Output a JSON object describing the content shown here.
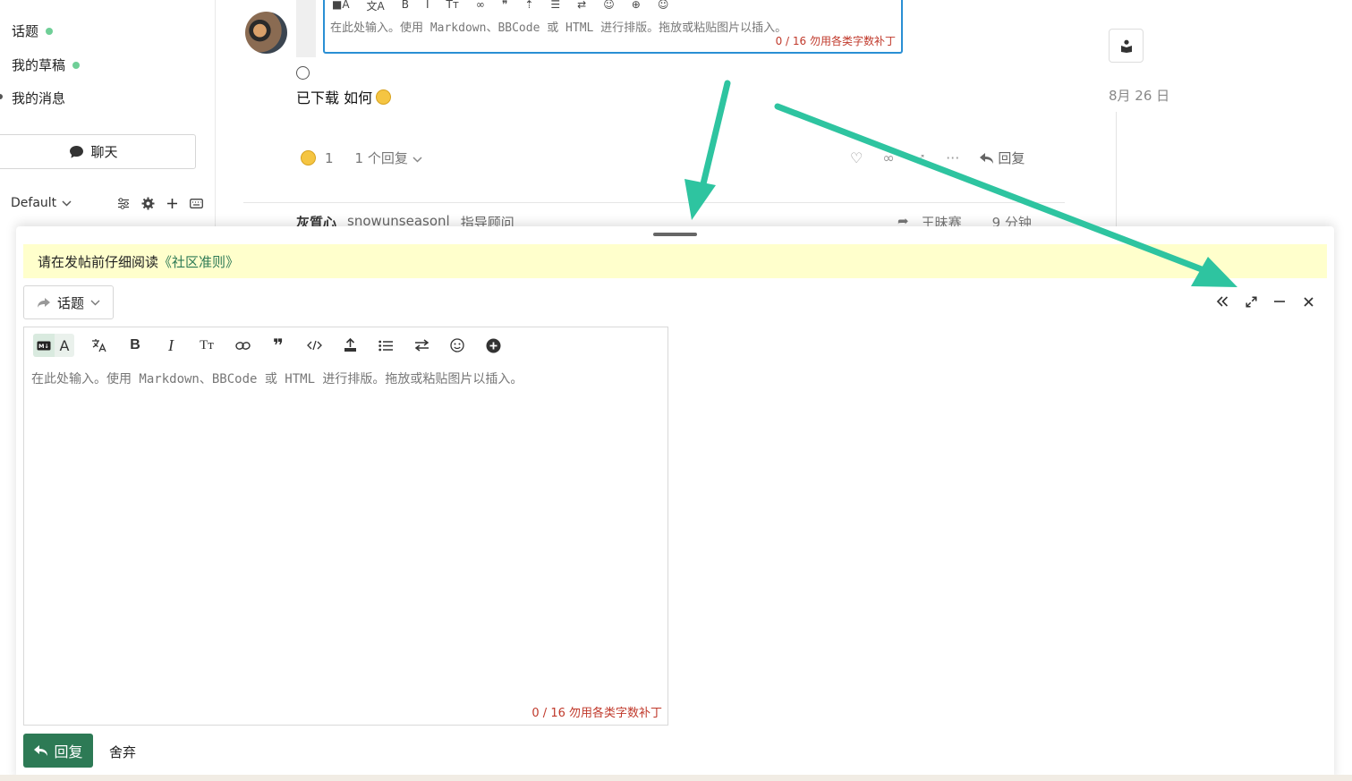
{
  "sidebar": {
    "items": [
      {
        "label": "话题"
      },
      {
        "label": "我的草稿"
      },
      {
        "label": "我的消息"
      }
    ],
    "chat_label": "聊天",
    "default_label": "Default"
  },
  "topic": {
    "mini_editor": {
      "placeholder": "在此处输入。使用 Markdown、BBCode 或 HTML 进行排版。拖放或粘贴图片以插入。",
      "char_count": "0 / 16 勿用各类字数补丁"
    },
    "post_text": "已下载 如何",
    "reaction_count": "1",
    "replies_label": "1 个回复",
    "reply_label": "回复",
    "date": "8月 26 日",
    "next_post": {
      "author": "灰質心",
      "username": "snowunseasonl",
      "role": "指导顾问",
      "replied_to": "王昧赛",
      "time": "9 分钟"
    }
  },
  "composer": {
    "notice_prefix": "请在发帖前仔细阅读",
    "notice_link": "《社区准则》",
    "action_label": "话题",
    "editor_placeholder": "在此处输入。使用 Markdown、BBCode 或 HTML 进行排版。拖放或粘贴图片以插入。",
    "char_count": "0 / 16 勿用各类字数补丁",
    "reply_button": "回复",
    "discard_button": "舍弃"
  },
  "colors": {
    "accent_green": "#2d7a55",
    "annotation_arrow": "#2ec4a0",
    "notice_bg": "#ffffcc",
    "count_red": "#c0392b"
  }
}
